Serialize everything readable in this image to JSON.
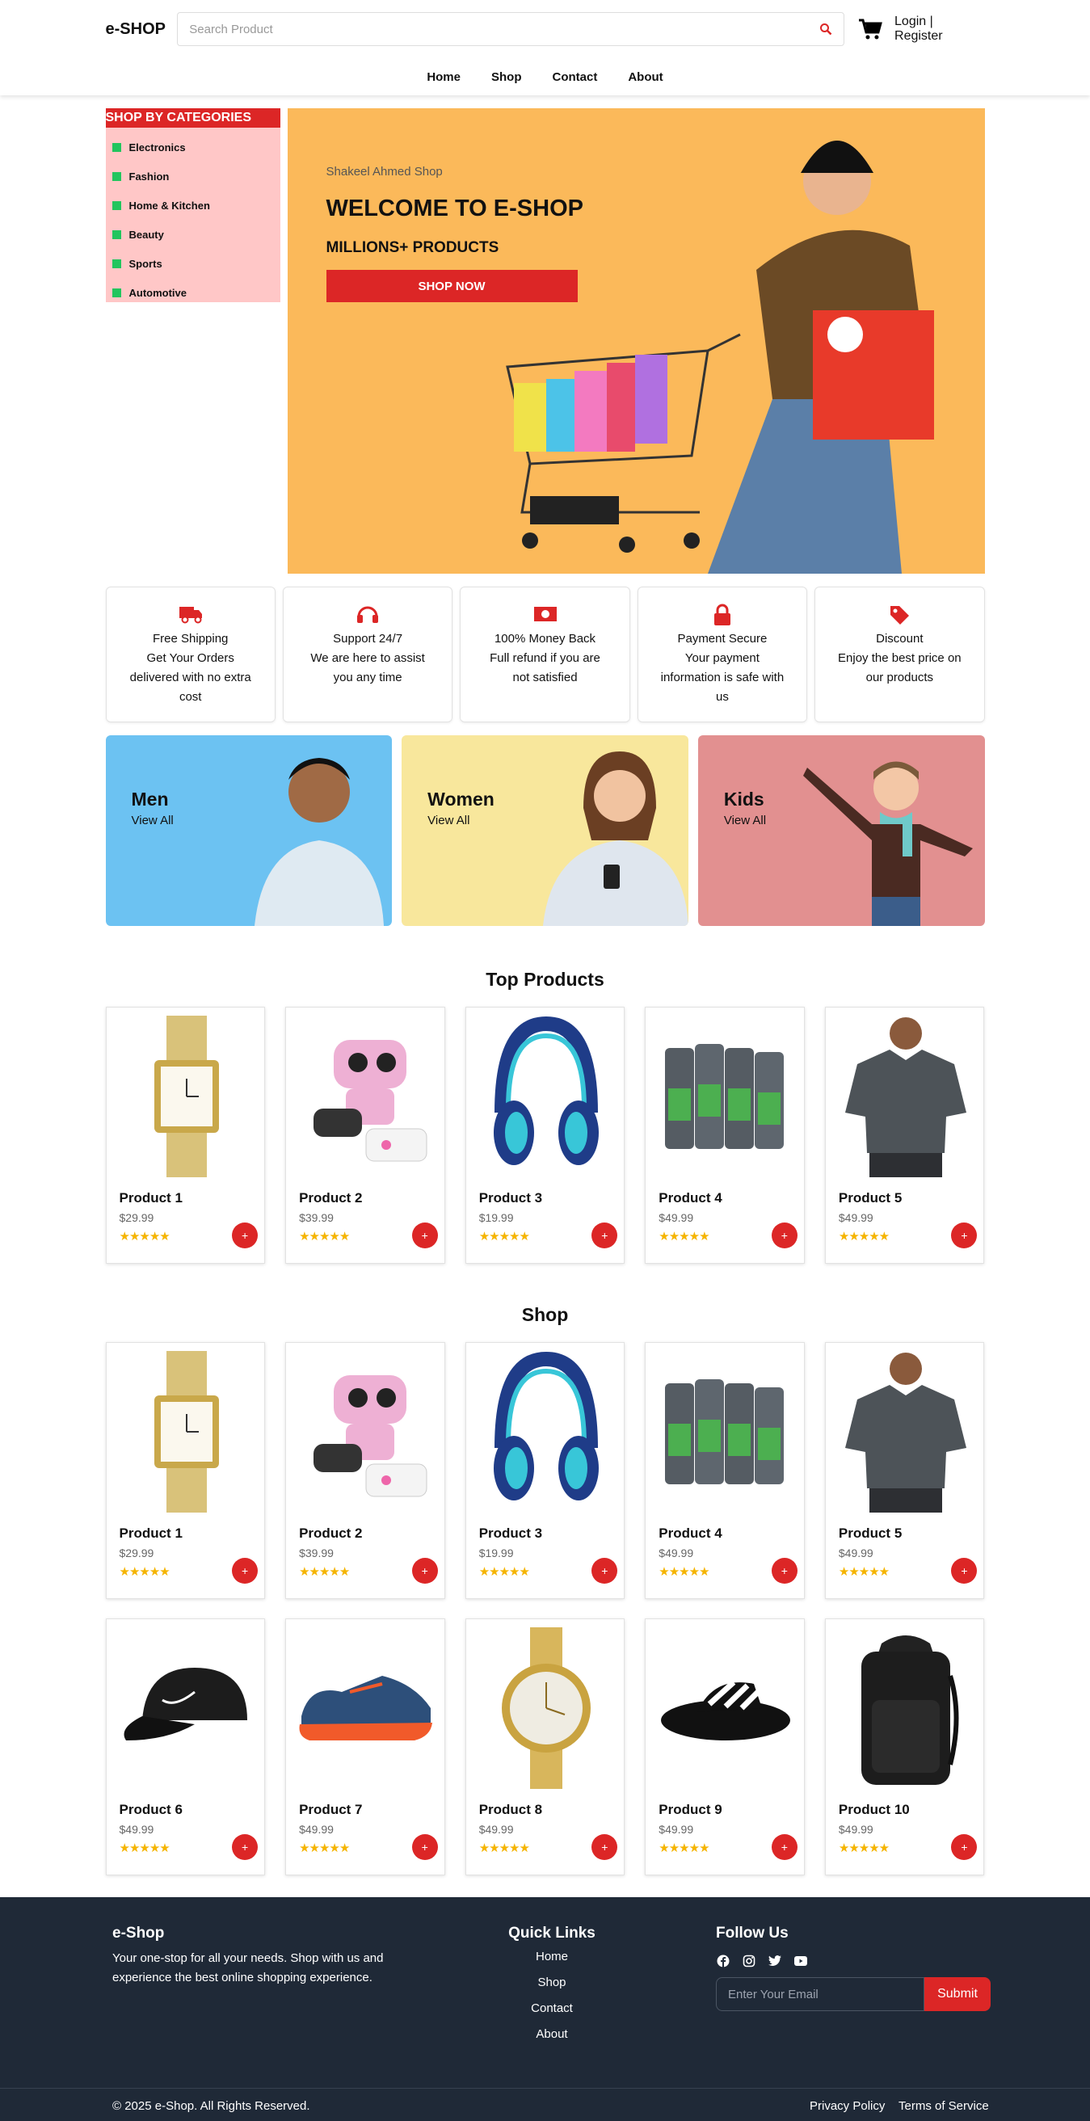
{
  "header": {
    "logo": "e-SHOP",
    "search_placeholder": "Search Product",
    "login": "Login | Register",
    "nav": [
      "Home",
      "Shop",
      "Contact",
      "About"
    ]
  },
  "categories": {
    "title": "SHOP BY CATEGORIES",
    "items": [
      "Electronics",
      "Fashion",
      "Home & Kitchen",
      "Beauty",
      "Sports",
      "Automotive"
    ]
  },
  "banner": {
    "subtitle": "Shakeel Ahmed Shop",
    "title": "WELCOME TO E-SHOP",
    "tagline": "MILLIONS+ PRODUCTS",
    "button": "SHOP NOW"
  },
  "features": [
    {
      "icon": "truck-icon",
      "title": "Free Shipping",
      "desc": "Get Your Orders delivered with no extra cost"
    },
    {
      "icon": "headset-icon",
      "title": "Support 24/7",
      "desc": "We are here to assist you any time"
    },
    {
      "icon": "money-icon",
      "title": "100% Money Back",
      "desc": "Full refund if you are not satisfied"
    },
    {
      "icon": "lock-icon",
      "title": "Payment Secure",
      "desc": "Your payment information is safe with us"
    },
    {
      "icon": "tag-icon",
      "title": "Discount",
      "desc": "Enjoy the best price on our products"
    }
  ],
  "category_cards": [
    {
      "title": "Men",
      "link": "View All",
      "color": "#6cc2f2"
    },
    {
      "title": "Women",
      "link": "View All",
      "color": "#f8e79c"
    },
    {
      "title": "Kids",
      "link": "View All",
      "color": "#e29090"
    }
  ],
  "top_products": {
    "title": "Top Products",
    "items": [
      {
        "name": "Product 1",
        "price": "$29.99",
        "image": "watch-icon"
      },
      {
        "name": "Product 2",
        "price": "$39.99",
        "image": "robot-icon"
      },
      {
        "name": "Product 3",
        "price": "$19.99",
        "image": "headphones-icon"
      },
      {
        "name": "Product 4",
        "price": "$49.99",
        "image": "bodywash-icon"
      },
      {
        "name": "Product 5",
        "price": "$49.99",
        "image": "shirt-icon"
      }
    ]
  },
  "shop": {
    "title": "Shop",
    "items": [
      {
        "name": "Product 1",
        "price": "$29.99",
        "image": "watch-icon"
      },
      {
        "name": "Product 2",
        "price": "$39.99",
        "image": "robot-icon"
      },
      {
        "name": "Product 3",
        "price": "$19.99",
        "image": "headphones-icon"
      },
      {
        "name": "Product 4",
        "price": "$49.99",
        "image": "bodywash-icon"
      },
      {
        "name": "Product 5",
        "price": "$49.99",
        "image": "shirt-icon"
      },
      {
        "name": "Product 6",
        "price": "$49.99",
        "image": "cap-icon"
      },
      {
        "name": "Product 7",
        "price": "$49.99",
        "image": "shoe-icon"
      },
      {
        "name": "Product 8",
        "price": "$49.99",
        "image": "gold-watch-icon"
      },
      {
        "name": "Product 9",
        "price": "$49.99",
        "image": "slide-icon"
      },
      {
        "name": "Product 10",
        "price": "$49.99",
        "image": "backpack-icon"
      }
    ]
  },
  "product_ui": {
    "stars": "★★★★★",
    "add": "+"
  },
  "footer": {
    "brand": "e-Shop",
    "about": "Your one-stop for all your needs. Shop with us and experience the best online shopping experience.",
    "quick_links_title": "Quick Links",
    "quick_links": [
      "Home",
      "Shop",
      "Contact",
      "About"
    ],
    "follow_title": "Follow Us",
    "email_placeholder": "Enter Your Email",
    "submit": "Submit",
    "copyright": "© 2025 e-Shop. All Rights Reserved.",
    "privacy": "Privacy Policy",
    "terms": "Terms of Service"
  }
}
